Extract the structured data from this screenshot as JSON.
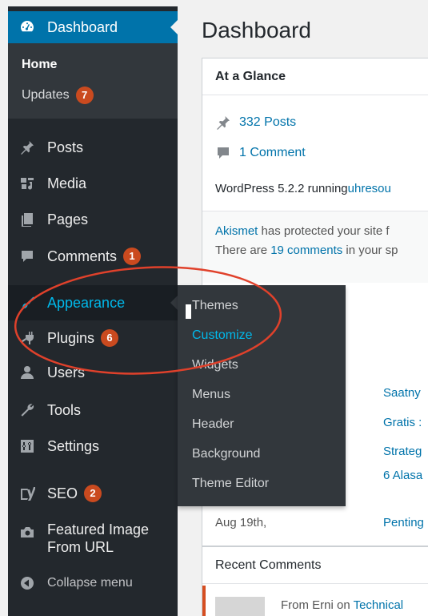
{
  "sidebar": {
    "dashboard": "Dashboard",
    "home": "Home",
    "updates": "Updates",
    "updates_count": "7",
    "posts": "Posts",
    "media": "Media",
    "pages": "Pages",
    "comments": "Comments",
    "comments_count": "1",
    "appearance": "Appearance",
    "plugins": "Plugins",
    "plugins_count": "6",
    "users": "Users",
    "tools": "Tools",
    "settings": "Settings",
    "seo": "SEO",
    "seo_count": "2",
    "featured_line1": "Featured Image",
    "featured_line2": "From URL",
    "collapse": "Collapse menu"
  },
  "flyout": {
    "themes": "Themes",
    "customize": "Customize",
    "widgets": "Widgets",
    "menus": "Menus",
    "header": "Header",
    "background": "Background",
    "theme_editor": "Theme Editor"
  },
  "main": {
    "title": "Dashboard",
    "glance": {
      "heading": "At a Glance",
      "posts": "332 Posts",
      "comments": "1 Comment",
      "wp_prefix": "WordPress 5.2.2 running ",
      "theme": "uhresou",
      "akismet": "Akismet",
      "akismet_rest": " has protected your site f",
      "there_are": "There are ",
      "comments_link": "19 comments",
      "in_your": " in your sp"
    },
    "activity_links": [
      "Saatny",
      "Gratis :",
      "Strateg",
      "6 Alasa"
    ],
    "date_row": {
      "date": "Aug 19th,",
      "link": "Penting"
    },
    "recent": {
      "heading": "Recent Comments",
      "from": "From Erni on ",
      "post": "Technical"
    }
  },
  "colors": {
    "sidebar_bg": "#23282d",
    "active_blue": "#0073aa",
    "highlight": "#00b9eb",
    "badge": "#ca4a1f",
    "annotation": "#e0412b"
  }
}
